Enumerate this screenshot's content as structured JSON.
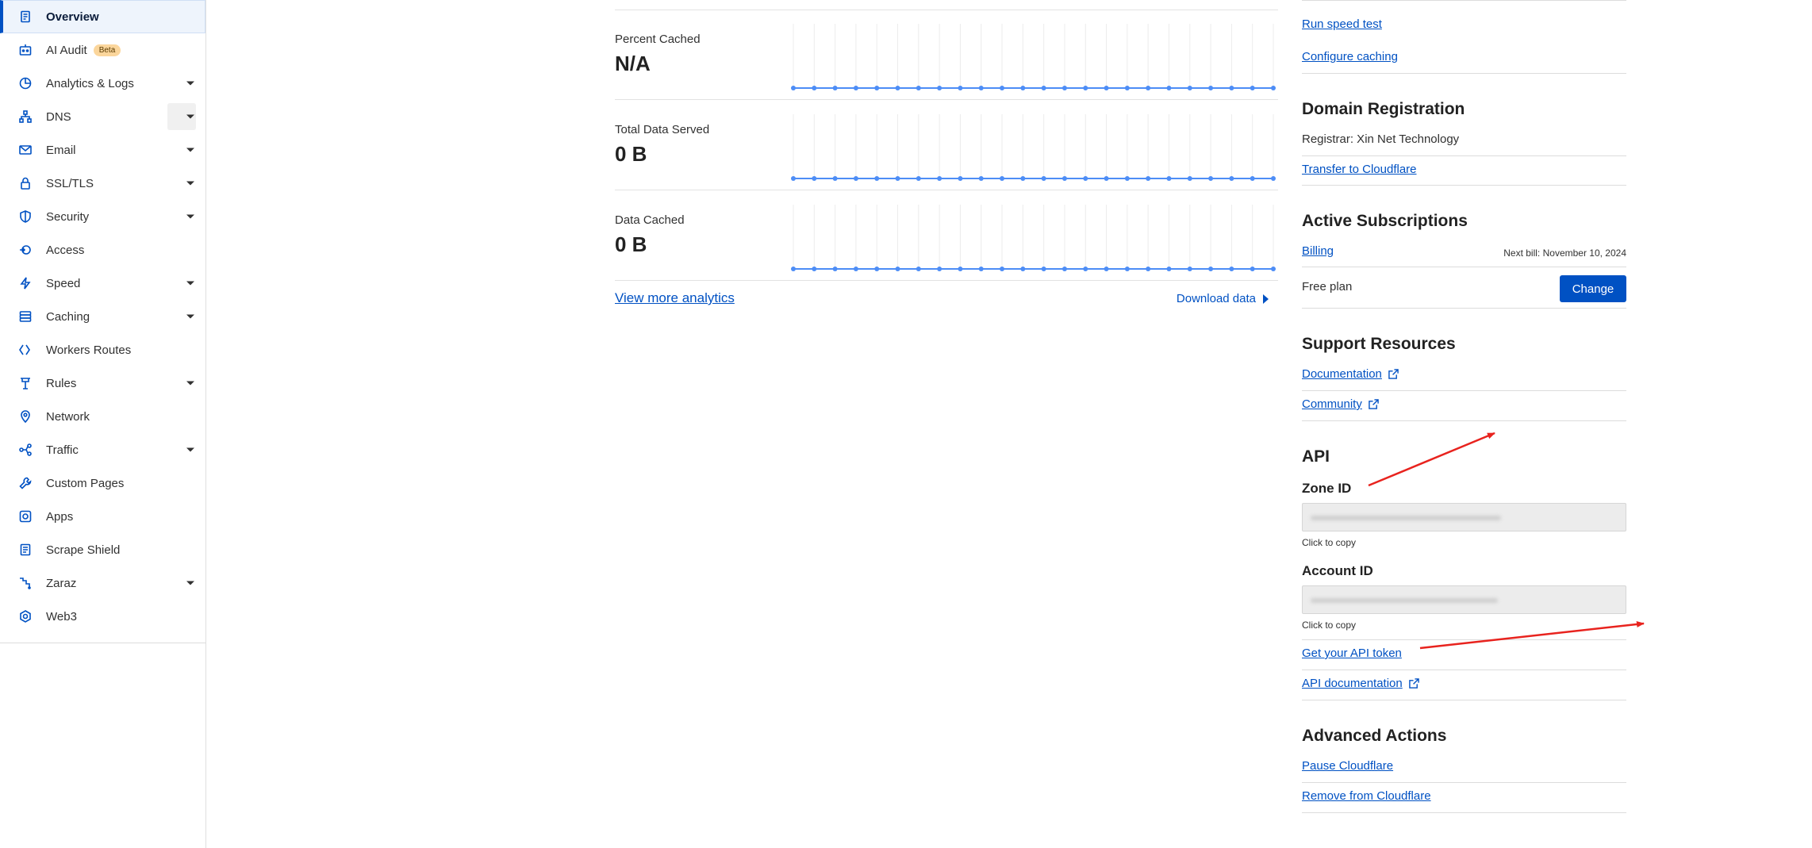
{
  "sidebar": {
    "items": [
      {
        "label": "Overview",
        "icon": "document-icon",
        "active": true,
        "expandable": false
      },
      {
        "label": "AI Audit",
        "icon": "ai-audit-icon",
        "badge": "Beta",
        "expandable": false
      },
      {
        "label": "Analytics & Logs",
        "icon": "analytics-icon",
        "expandable": true
      },
      {
        "label": "DNS",
        "icon": "dns-icon",
        "expandable": true,
        "hovered": true
      },
      {
        "label": "Email",
        "icon": "email-icon",
        "expandable": true
      },
      {
        "label": "SSL/TLS",
        "icon": "lock-icon",
        "expandable": true
      },
      {
        "label": "Security",
        "icon": "shield-icon",
        "expandable": true
      },
      {
        "label": "Access",
        "icon": "access-icon",
        "expandable": false
      },
      {
        "label": "Speed",
        "icon": "lightning-icon",
        "expandable": true
      },
      {
        "label": "Caching",
        "icon": "caching-icon",
        "expandable": true
      },
      {
        "label": "Workers Routes",
        "icon": "workers-icon",
        "expandable": false
      },
      {
        "label": "Rules",
        "icon": "rules-icon",
        "expandable": true
      },
      {
        "label": "Network",
        "icon": "location-pin-icon",
        "expandable": false
      },
      {
        "label": "Traffic",
        "icon": "traffic-icon",
        "expandable": true
      },
      {
        "label": "Custom Pages",
        "icon": "wrench-icon",
        "expandable": false
      },
      {
        "label": "Apps",
        "icon": "apps-icon",
        "expandable": false
      },
      {
        "label": "Scrape Shield",
        "icon": "scrape-shield-icon",
        "expandable": false
      },
      {
        "label": "Zaraz",
        "icon": "zaraz-icon",
        "expandable": true
      },
      {
        "label": "Web3",
        "icon": "web3-icon",
        "expandable": false
      }
    ]
  },
  "analytics": {
    "metrics": [
      {
        "label": "Percent Cached",
        "value": "N/A"
      },
      {
        "label": "Total Data Served",
        "value": "0 B"
      },
      {
        "label": "Data Cached",
        "value": "0 B"
      }
    ],
    "view_more": "View more analytics",
    "download": "Download data"
  },
  "right": {
    "speed_links": [
      "Run speed test",
      "Configure caching"
    ],
    "domain_registration": {
      "title": "Domain Registration",
      "registrar": "Registrar: Xin Net Technology",
      "transfer": "Transfer to Cloudflare"
    },
    "subscriptions": {
      "title": "Active Subscriptions",
      "billing": "Billing",
      "next_bill": "Next bill: November 10, 2024",
      "plan": "Free plan",
      "change": "Change"
    },
    "support": {
      "title": "Support Resources",
      "documentation": "Documentation",
      "community": "Community"
    },
    "api": {
      "title": "API",
      "zone_id_label": "Zone ID",
      "account_id_label": "Account ID",
      "click_to_copy": "Click to copy",
      "get_token": "Get your API token",
      "api_docs": "API documentation"
    },
    "advanced": {
      "title": "Advanced Actions",
      "pause": "Pause Cloudflare",
      "remove": "Remove from Cloudflare"
    }
  },
  "colors": {
    "accent": "#0051c3",
    "chart_line": "#4d8df6",
    "annotation_arrow": "#e8231e"
  }
}
